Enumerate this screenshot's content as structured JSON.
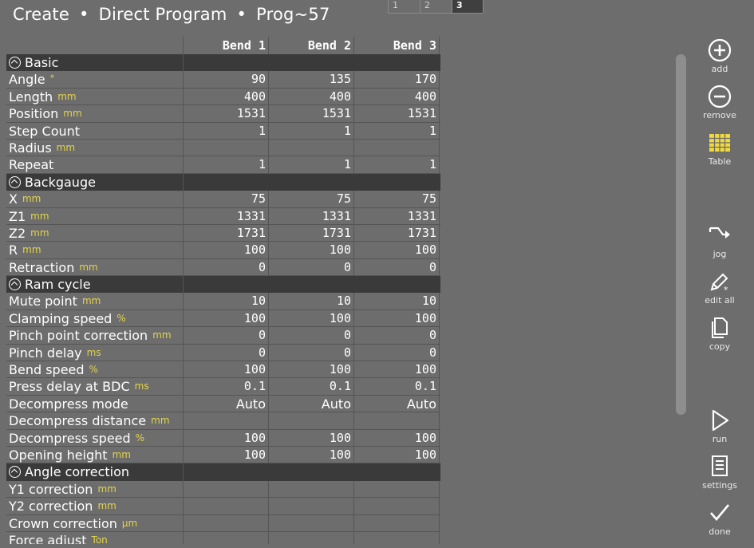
{
  "header": {
    "crumbs": [
      "Create",
      "Direct Program",
      "Prog~57"
    ],
    "separator": "•"
  },
  "pages": [
    {
      "label": "1",
      "active": false
    },
    {
      "label": "2",
      "active": false
    },
    {
      "label": "3",
      "active": true
    }
  ],
  "columns": [
    "Bend 1",
    "Bend 2",
    "Bend 3"
  ],
  "rows": [
    {
      "section": "Basic"
    },
    {
      "label": "Angle",
      "unit": "°",
      "values": [
        "90",
        "135",
        "170"
      ]
    },
    {
      "label": "Length",
      "unit": "mm",
      "values": [
        "400",
        "400",
        "400"
      ]
    },
    {
      "label": "Position",
      "unit": "mm",
      "values": [
        "1531",
        "1531",
        "1531"
      ]
    },
    {
      "label": "Step Count",
      "unit": "",
      "values": [
        "1",
        "1",
        "1"
      ]
    },
    {
      "label": "Radius",
      "unit": "mm",
      "values": [
        "",
        "",
        ""
      ]
    },
    {
      "label": "Repeat",
      "unit": "",
      "values": [
        "1",
        "1",
        "1"
      ]
    },
    {
      "section": "Backgauge"
    },
    {
      "label": "X",
      "unit": "mm",
      "values": [
        "75",
        "75",
        "75"
      ]
    },
    {
      "label": "Z1",
      "unit": "mm",
      "values": [
        "1331",
        "1331",
        "1331"
      ]
    },
    {
      "label": "Z2",
      "unit": "mm",
      "values": [
        "1731",
        "1731",
        "1731"
      ]
    },
    {
      "label": "R",
      "unit": "mm",
      "values": [
        "100",
        "100",
        "100"
      ]
    },
    {
      "label": "Retraction",
      "unit": "mm",
      "values": [
        "0",
        "0",
        "0"
      ]
    },
    {
      "section": "Ram cycle"
    },
    {
      "label": "Mute point",
      "unit": "mm",
      "values": [
        "10",
        "10",
        "10"
      ]
    },
    {
      "label": "Clamping speed",
      "unit": "%",
      "values": [
        "100",
        "100",
        "100"
      ]
    },
    {
      "label": "Pinch point correction",
      "unit": "mm",
      "values": [
        "0",
        "0",
        "0"
      ]
    },
    {
      "label": "Pinch delay",
      "unit": "ms",
      "values": [
        "0",
        "0",
        "0"
      ]
    },
    {
      "label": "Bend speed",
      "unit": "%",
      "values": [
        "100",
        "100",
        "100"
      ]
    },
    {
      "label": "Press delay at BDC",
      "unit": "ms",
      "values": [
        "0.1",
        "0.1",
        "0.1"
      ]
    },
    {
      "label": "Decompress mode",
      "unit": "",
      "values": [
        "Auto",
        "Auto",
        "Auto"
      ],
      "text": true
    },
    {
      "label": "Decompress distance",
      "unit": "mm",
      "values": [
        "",
        "",
        ""
      ]
    },
    {
      "label": "Decompress speed",
      "unit": "%",
      "values": [
        "100",
        "100",
        "100"
      ]
    },
    {
      "label": "Opening height",
      "unit": "mm",
      "values": [
        "100",
        "100",
        "100"
      ]
    },
    {
      "section": "Angle correction"
    },
    {
      "label": "Y1 correction",
      "unit": "mm",
      "values": [
        "",
        "",
        ""
      ]
    },
    {
      "label": "Y2 correction",
      "unit": "mm",
      "values": [
        "",
        "",
        ""
      ]
    },
    {
      "label": "Crown correction",
      "unit": "µm",
      "values": [
        "",
        "",
        ""
      ]
    },
    {
      "label": "Force adjust",
      "unit": "Ton",
      "values": [
        "",
        "",
        ""
      ]
    }
  ],
  "tools": [
    {
      "id": "add",
      "label": "add",
      "icon": "plus-circle-icon"
    },
    {
      "id": "remove",
      "label": "remove",
      "icon": "minus-circle-icon"
    },
    {
      "id": "table",
      "label": "Table",
      "icon": "table-grid-icon"
    },
    {
      "id": "jog",
      "label": "jog",
      "icon": "jog-arrow-icon"
    },
    {
      "id": "edit-all",
      "label": "edit all",
      "icon": "pencil-asterisk-icon"
    },
    {
      "id": "copy",
      "label": "copy",
      "icon": "copy-pages-icon"
    },
    {
      "id": "run",
      "label": "run",
      "icon": "play-triangle-icon"
    },
    {
      "id": "settings",
      "label": "settings",
      "icon": "settings-doc-icon"
    },
    {
      "id": "done",
      "label": "done",
      "icon": "checkmark-icon"
    }
  ],
  "colors": {
    "background": "#6d6d6d",
    "section": "#3a3a3a",
    "unit": "#e3d44a",
    "table_icon": "#f2d93a"
  }
}
